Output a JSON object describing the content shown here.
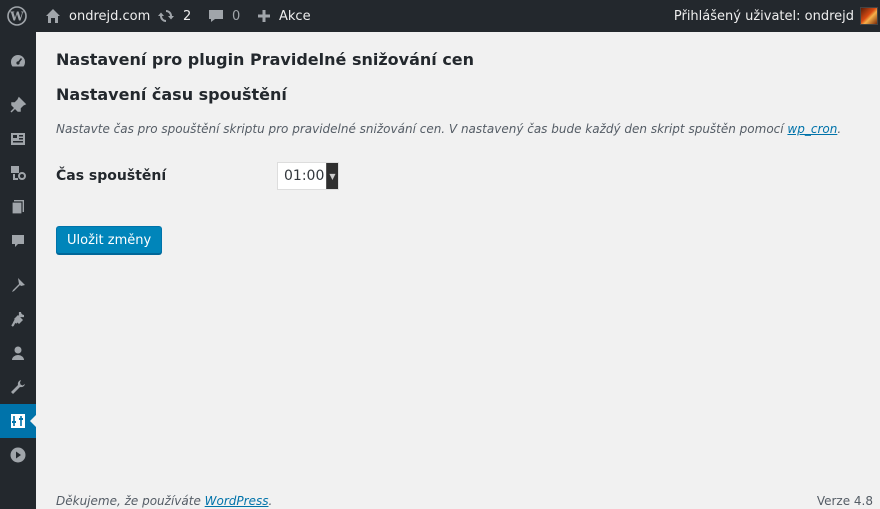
{
  "adminbar": {
    "site_name": "ondrejd.com",
    "updates_count": "2",
    "comments_count": "0",
    "new_label": "Akce",
    "account_label": "Přihlášený uživatel: ondrejd",
    "icons": [
      "wordpress-logo-icon",
      "home-icon",
      "updates-icon",
      "comment-icon",
      "plus-icon"
    ]
  },
  "sidebar": {
    "items": [
      {
        "icon": "dashboard-icon"
      },
      {
        "icon": "pin-icon"
      },
      {
        "icon": "media-icon"
      },
      {
        "icon": "links-icon"
      },
      {
        "icon": "pages-icon"
      },
      {
        "icon": "comments-icon"
      },
      {
        "icon": "appearance-icon"
      },
      {
        "icon": "plugins-icon"
      },
      {
        "icon": "users-icon"
      },
      {
        "icon": "tools-icon"
      },
      {
        "icon": "settings-icon",
        "current": true
      },
      {
        "icon": "collapse-icon"
      }
    ]
  },
  "main": {
    "page_title": "Nastavení pro plugin Pravidelné snižování cen",
    "section_title": "Nastavení času spouštění",
    "description_prefix": "Nastavte čas pro spouštění skriptu pro pravidelné snižování cen. V nastavený čas bude každý den skript spuštěn pomocí ",
    "description_link": "wp_cron",
    "description_suffix": ".",
    "field_label": "Čas spouštění",
    "time_value": "01:00",
    "save_button": "Uložit změny"
  },
  "footer": {
    "thanks_prefix": "Děkujeme, že používáte ",
    "thanks_link": "WordPress",
    "thanks_suffix": ".",
    "version": "Verze 4.8"
  },
  "colors": {
    "adminbar_bg": "#23282d",
    "accent": "#0073aa",
    "button": "#0085ba",
    "background": "#f1f1f1"
  }
}
